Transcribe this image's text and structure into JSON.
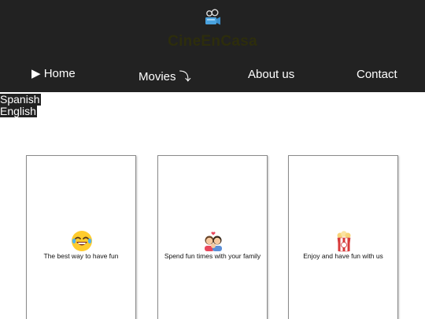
{
  "header": {
    "logo_icon": "camera-icon",
    "brand_name": "CineEnCasa",
    "brand_color": "#2d2d0c",
    "background": "#222222"
  },
  "nav": {
    "home_label": "▶ Home",
    "movies_label": "Movies ⤵",
    "about_label": "About us",
    "contact_label": "Contact"
  },
  "languages": [
    "Spanish",
    "English"
  ],
  "cards": [
    {
      "icon": "laughing-face-icon",
      "text": "The best way to have fun"
    },
    {
      "icon": "family-icon",
      "text": "Spend fun times with your family"
    },
    {
      "icon": "popcorn-icon",
      "text": "Enjoy and have fun with us"
    }
  ]
}
